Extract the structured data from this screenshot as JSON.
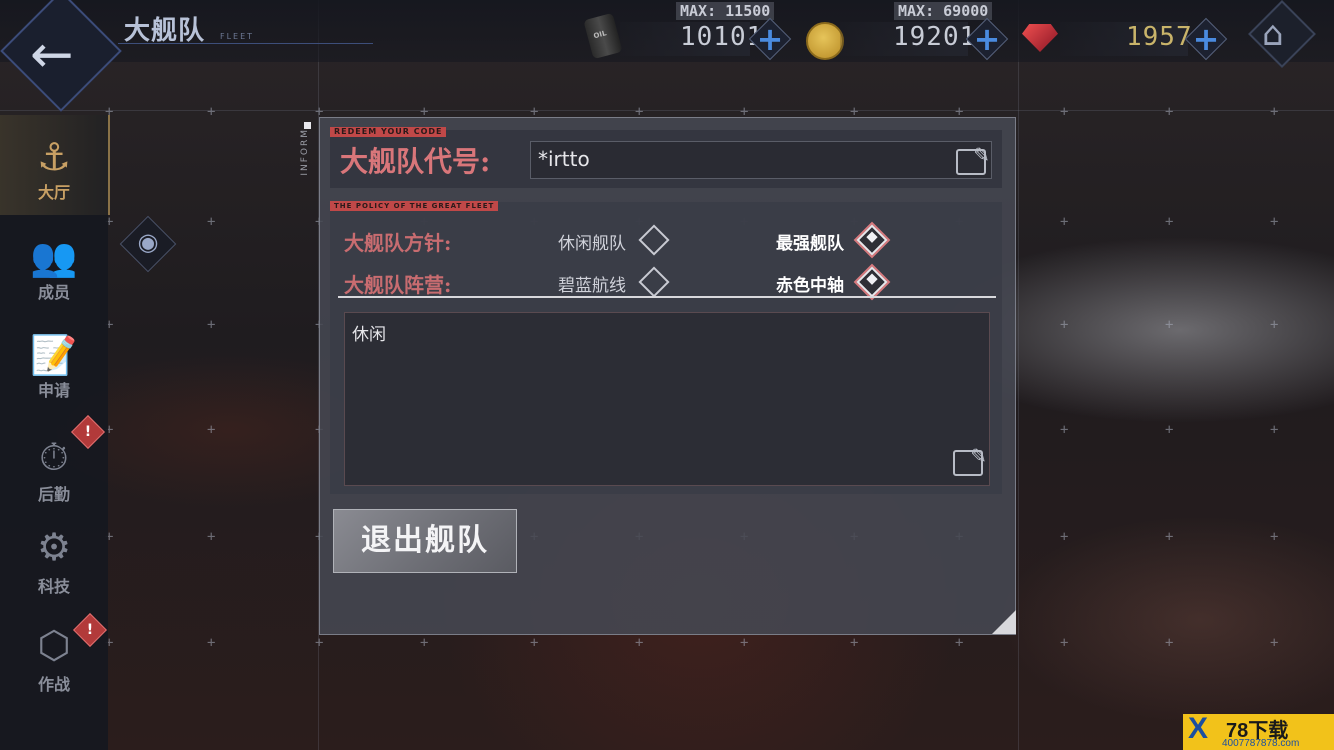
{
  "header": {
    "title": "大舰队",
    "subtitle": "FLEET"
  },
  "resources": {
    "oil": {
      "max": "MAX: 11500",
      "value": "10101",
      "icon": "oil-barrel-icon"
    },
    "coin": {
      "max": "MAX: 69000",
      "value": "19201",
      "icon": "gold-coin-icon"
    },
    "gem": {
      "value": "1957",
      "icon": "ruby-gem-icon"
    }
  },
  "sidebar": {
    "items": [
      {
        "label": "大厅",
        "icon": "anchor-icon",
        "glyph": "⚓",
        "active": true
      },
      {
        "label": "成员",
        "icon": "members-icon",
        "glyph": "👥",
        "active": false
      },
      {
        "label": "申请",
        "icon": "application-icon",
        "glyph": "📝",
        "active": false
      },
      {
        "label": "后勤",
        "icon": "logistics-icon",
        "glyph": "⏱",
        "active": false,
        "alert": "!"
      },
      {
        "label": "科技",
        "icon": "tech-icon",
        "glyph": "⚙",
        "active": false
      },
      {
        "label": "作战",
        "icon": "battle-icon",
        "glyph": "⬡",
        "active": false,
        "alert": "!"
      }
    ]
  },
  "panel": {
    "inform": "INFORM",
    "redeem_tag": "REDEEM YOUR CODE",
    "code_label": "大舰队代号:",
    "code_value": "*irtto",
    "policy_tag": "THE POLICY OF THE GREAT FLEET",
    "policy": {
      "label": "大舰队方针:",
      "options": [
        {
          "text": "休闲舰队",
          "selected": false
        },
        {
          "text": "最强舰队",
          "selected": true
        }
      ]
    },
    "camp": {
      "label": "大舰队阵营:",
      "options": [
        {
          "text": "碧蓝航线",
          "selected": false
        },
        {
          "text": "赤色中轴",
          "selected": true
        }
      ]
    },
    "description": "休闲",
    "quit_label": "退出舰队"
  },
  "watermark": {
    "brand": "78下载",
    "url": "4007787878.com"
  },
  "colors": {
    "accent_red": "#d9767a",
    "accent_blue": "#4a8be0",
    "active_gold": "#c8a064"
  }
}
